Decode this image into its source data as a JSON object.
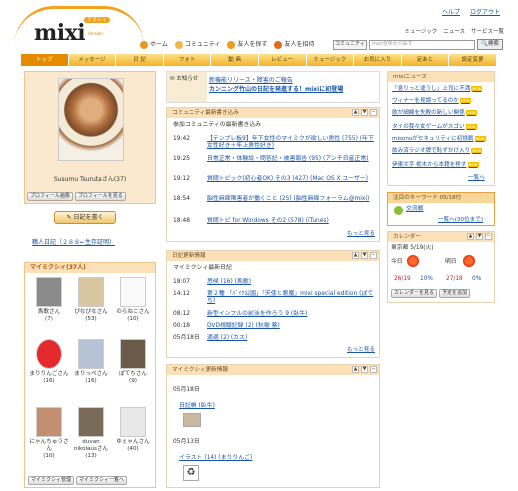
{
  "brand": {
    "logo": "mixi",
    "badge": "ミクシィ",
    "subtitle": "Version"
  },
  "top_links": [
    "ヘルプ",
    "ログアウト"
  ],
  "global_nav": [
    {
      "label": "ホーム",
      "icon": "home-icon",
      "color": "#e99a1c"
    },
    {
      "label": "コミュニティ",
      "icon": "community-icon",
      "color": "#f0b64a"
    },
    {
      "label": "友人を探す",
      "icon": "find-friends-icon",
      "color": "#f09a1c"
    },
    {
      "label": "友人を招待",
      "icon": "invite-icon",
      "color": "#e06a1c"
    }
  ],
  "tools": [
    "ミュージック",
    "ニュース",
    "サービス一覧"
  ],
  "search": {
    "scope": "コミュニティ",
    "placeholder": "mixi全体から探す",
    "button": "検索"
  },
  "tabs": [
    "トップ",
    "メッセージ",
    "日 記",
    "フォト",
    "動 画",
    "レビュー",
    "ミュージック",
    "お気に入り",
    "足あと",
    "設定変更"
  ],
  "profile": {
    "name": "Susumu Tsurutaさん(37)",
    "buttons": [
      "プロフィール画像",
      "プロフィールを見る"
    ],
    "write": "日記を書く",
    "archive": "鶴人日記（２８８←生存証明）"
  },
  "mymixi": {
    "title": "マイミクシィ(37人)",
    "friends": [
      {
        "name": "馬歌さん",
        "count": "(7)",
        "color": "#8a8a8a"
      },
      {
        "name": "ぴなぴなさん",
        "count": "(53)",
        "color": "#d8c6a0"
      },
      {
        "name": "のらねこさん",
        "count": "(10)",
        "color": "#fafafa"
      },
      {
        "name": "まりりんごさん",
        "count": "(16)",
        "color": "#e42a2a"
      },
      {
        "name": "まりっぺさん",
        "count": "(16)",
        "color": "#b6c2d6"
      },
      {
        "name": "ぽてちさん",
        "count": "(9)",
        "color": "#6a5a48"
      },
      {
        "name": "にゃんちゅうさん",
        "count": "(10)",
        "color": "#c09070"
      },
      {
        "name": "duvan nikolausさん",
        "count": "(13)",
        "color": "#7a6a58"
      },
      {
        "name": "ゆぇゃんさん",
        "count": "(40)",
        "color": "#e8e8e8"
      }
    ],
    "buttons": [
      "マイミクシィ管理",
      "マイミクシィ一覧へ"
    ]
  },
  "notice": {
    "label": "お知らせ",
    "lines": [
      "新機能リリース・障害のご報告",
      "カンニング竹山の日記を発進する！mixiに初登場"
    ]
  },
  "community": {
    "title": "コミュニティ最新書き込み",
    "intro": "参加コミュニティの最新書き込み",
    "rows": [
      {
        "time": "19:42",
        "text": "【テンプレ板9】年下女性のマイミクが欲しい男性 (755) (年下女性好き＋年上男性好き)"
      },
      {
        "time": "19:25",
        "text": "日常正常・体験談・問答記・被害報告 (95) (アンチ日産正常)"
      },
      {
        "time": "19:12",
        "text": "質問トピック(初心者OK) その3 (427) (Mac OS X ユーザー)"
      },
      {
        "time": "18:54",
        "text": "脳性麻痺障害者が働くこと (25) (脳性麻痺フォーラム@mixi)"
      },
      {
        "time": "18:48",
        "text": "質問トピ for Windows その2 (578) (iTunes)"
      }
    ],
    "more": "もっと見る"
  },
  "diary": {
    "title": "日記更新情報",
    "intro": "マイミクシィ最新日記",
    "rows": [
      {
        "time": "18:07",
        "text": "思候 (16) (馬歌)"
      },
      {
        "time": "14:12",
        "text": "第２種 「ﾊﾞｲｸ公園」「天使と悪魔」mixi special edition (ぽてち)"
      },
      {
        "time": "08:12",
        "text": "新型インフルの前泳を作ろう 9 (臥牛)"
      },
      {
        "time": "00:18",
        "text": "DVD視聴記録 (2) (秋樹 蔡)"
      },
      {
        "time": "05月18日",
        "text": "適適 (2) (カス)"
      }
    ],
    "more": "もっと見る"
  },
  "updates": {
    "title": "マイミクシィ更新情報",
    "dates": [
      "05月18日",
      "05月13日"
    ],
    "items": [
      "日記帳 (臥牛)",
      "イラスト (14) (まりりんご)"
    ]
  },
  "mixi_news": {
    "title": "mixiニュース",
    "items": [
      "「息りっと違うし」上司に不満",
      "ウィナーを見誤ってるのか",
      "飲が細線を失敗の新しい関係",
      "タイの我々女ゲームがスゴい",
      "misonoがセキュリティに初挑戦",
      "飲み済ラジオ牌で恥ずかけ入り",
      "伊東文字 栃木から本籍を移す"
    ],
    "more": "一覧へ"
  },
  "keyword": {
    "title": "注目のキーワード 05/18付",
    "word": "交流戦",
    "link": "一覧へ(30位まで)"
  },
  "calendar": {
    "title": "カレンダー",
    "date": "東京都 5/19(火)",
    "today": "今日",
    "tomorrow": "明日",
    "t_today": "26/19",
    "p_today": "10%",
    "t_tom": "27/18",
    "p_tom": "0%",
    "buttons": [
      "カレンダーを見る",
      "予定を追加"
    ]
  }
}
